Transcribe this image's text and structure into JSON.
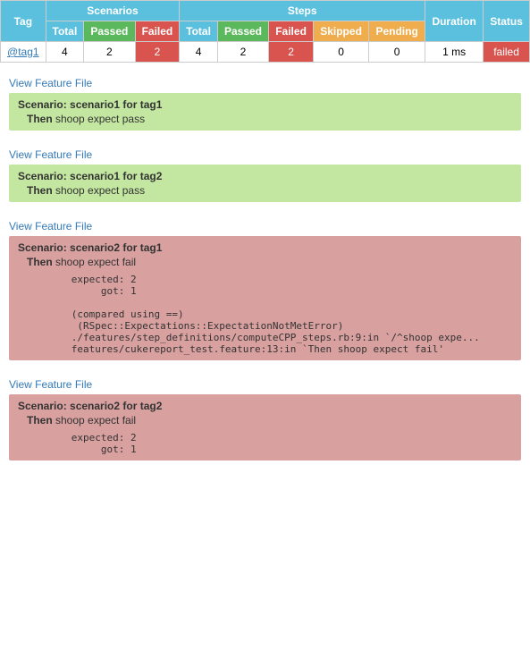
{
  "table": {
    "scenarios_label": "Scenarios",
    "steps_label": "Steps",
    "columns": {
      "tag": "Tag",
      "total": "Total",
      "passed": "Passed",
      "failed": "Failed",
      "steps_total": "Total",
      "steps_passed": "Passed",
      "steps_failed": "Failed",
      "skipped": "Skipped",
      "pending": "Pending",
      "duration": "Duration",
      "status": "Status"
    },
    "row": {
      "tag": "@tag1",
      "sc_total": "4",
      "sc_passed": "2",
      "sc_failed": "2",
      "st_total": "4",
      "st_passed": "2",
      "st_failed": "2",
      "skipped": "0",
      "pending": "0",
      "duration": "1 ms",
      "status": "failed"
    }
  },
  "scenarios": [
    {
      "id": 1,
      "link_label": "View Feature File",
      "type": "passed",
      "title_keyword": "Scenario:",
      "title_text": "scenario1 for tag1",
      "step_keyword": "Then",
      "step_text": "shoop expect pass",
      "has_error": false,
      "error_text": ""
    },
    {
      "id": 2,
      "link_label": "View Feature File",
      "type": "passed",
      "title_keyword": "Scenario:",
      "title_text": "scenario1 for tag2",
      "step_keyword": "Then",
      "step_text": "shoop expect pass",
      "has_error": false,
      "error_text": ""
    },
    {
      "id": 3,
      "link_label": "View Feature File",
      "type": "failed",
      "title_keyword": "Scenario:",
      "title_text": "scenario2 for tag1",
      "step_keyword": "Then",
      "step_text": "shoop expect fail",
      "has_error": true,
      "error_text": "      expected: 2\n           got: 1\n\n      (compared using ==)\n       (RSpec::Expectations::ExpectationNotMetError)\n      ./features/step_definitions/computeCPP_steps.rb:9:in `/^shoop expe...\n      features/cukereport_test.feature:13:in `Then shoop expect fail'"
    },
    {
      "id": 4,
      "link_label": "View Feature File",
      "type": "failed",
      "title_keyword": "Scenario:",
      "title_text": "scenario2 for tag2",
      "step_keyword": "Then",
      "step_text": "shoop expect fail",
      "has_error": true,
      "error_text": "      expected: 2\n           got: 1"
    }
  ]
}
